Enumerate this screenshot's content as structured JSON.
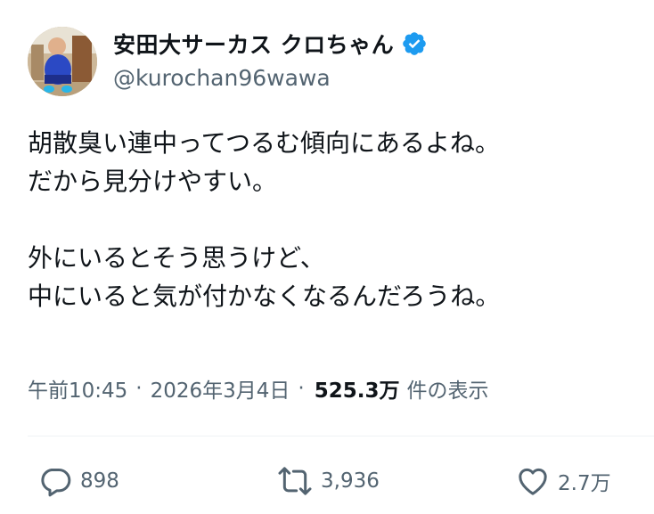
{
  "user": {
    "display_name": "安田大サーカス クロちゃん",
    "handle": "@kurochan96wawa",
    "verified_icon": "verified-badge-icon",
    "verified_color": "#1d9bf0"
  },
  "tweet": {
    "text": "胡散臭い連中ってつるむ傾向にあるよね。\nだから見分けやすい。\n\n外にいるとそう思うけど、\n中にいると気が付かなくなるんだろうね。",
    "time": "午前10:45",
    "separator": "·",
    "date": "2026年3月4日",
    "views": "525.3万",
    "views_label": "件の表示"
  },
  "actions": {
    "reply": {
      "icon": "reply-icon",
      "count": "898"
    },
    "retweet": {
      "icon": "retweet-icon",
      "count": "3,936"
    },
    "like": {
      "icon": "heart-icon",
      "count": "2.7万"
    }
  },
  "colors": {
    "text": "#0f1419",
    "secondary": "#536471",
    "divider": "#eff3f4"
  }
}
